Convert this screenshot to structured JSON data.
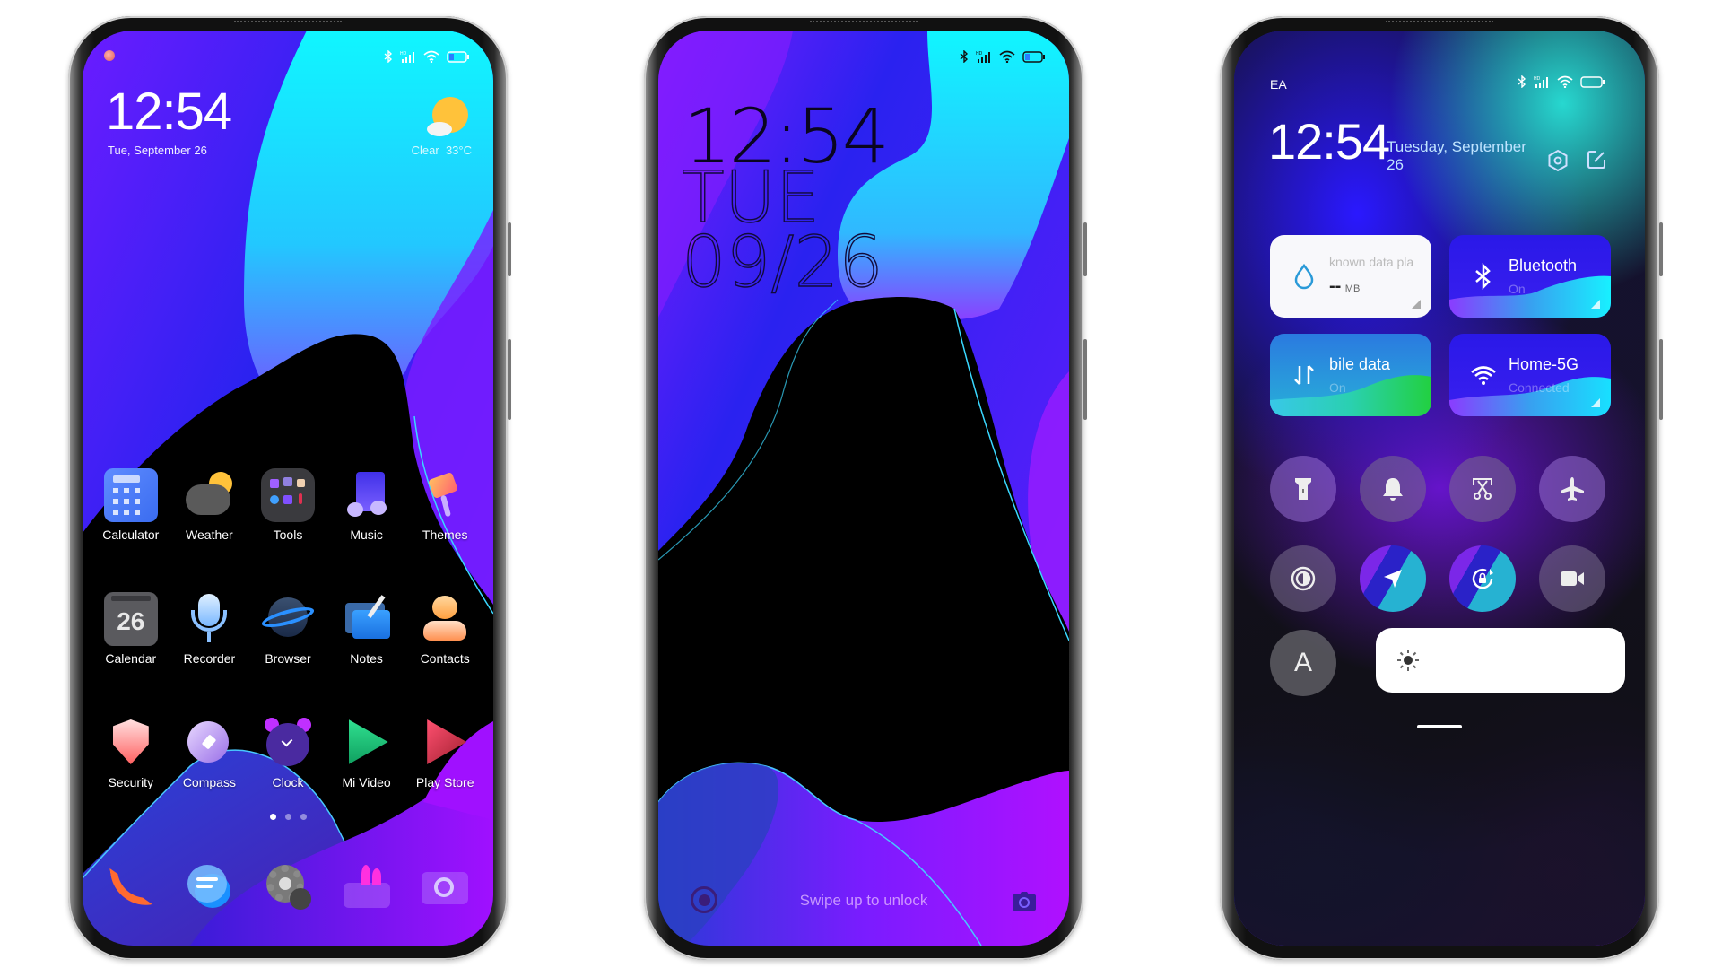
{
  "status_bar": {
    "icons": [
      "bluetooth-icon",
      "hd-signal-icon",
      "wifi-icon",
      "battery-icon"
    ]
  },
  "home_screen": {
    "clock": "12:54",
    "date": "Tue, September 26",
    "weather": {
      "condition": "Clear",
      "temperature": "33°C",
      "icon": "sun-cloud-icon"
    },
    "apps_row1": [
      {
        "label": "Calculator",
        "icon": "calculator-icon"
      },
      {
        "label": "Weather",
        "icon": "weather-icon"
      },
      {
        "label": "Tools",
        "icon": "tools-folder-icon"
      },
      {
        "label": "Music",
        "icon": "music-icon"
      },
      {
        "label": "Themes",
        "icon": "themes-icon"
      }
    ],
    "apps_row2": [
      {
        "label": "Calendar",
        "icon": "calendar-icon",
        "badge": "26"
      },
      {
        "label": "Recorder",
        "icon": "recorder-icon"
      },
      {
        "label": "Browser",
        "icon": "browser-icon"
      },
      {
        "label": "Notes",
        "icon": "notes-icon"
      },
      {
        "label": "Contacts",
        "icon": "contacts-icon"
      }
    ],
    "apps_row3": [
      {
        "label": "Security",
        "icon": "security-icon"
      },
      {
        "label": "Compass",
        "icon": "compass-icon"
      },
      {
        "label": "Clock",
        "icon": "clock-icon"
      },
      {
        "label": "Mi Video",
        "icon": "mi-video-icon"
      },
      {
        "label": "Play Store",
        "icon": "play-store-icon"
      }
    ],
    "page_indicator": {
      "pages": 3,
      "current": 1
    },
    "dock": [
      "phone-icon",
      "messages-icon",
      "settings-icon",
      "gallery-icon",
      "camera-icon"
    ]
  },
  "lock_screen": {
    "time": "12:54",
    "day": "TUE",
    "date": "09/26",
    "hint": "Swipe up to unlock"
  },
  "control_center": {
    "carrier": "EA",
    "time": "12:54",
    "date": "Tuesday, September 26",
    "tiles": [
      {
        "title": "known data pla",
        "value": "--",
        "unit": "MB",
        "icon": "water-drop-icon"
      },
      {
        "title": "Bluetooth",
        "sub": "On",
        "icon": "bluetooth-icon"
      },
      {
        "title": "bile data",
        "sub": "On",
        "icon": "mobile-data-icon"
      },
      {
        "title": "Home-5G",
        "sub": "Connected",
        "icon": "wifi-icon"
      }
    ],
    "toggles_row1": [
      "flashlight-icon",
      "bell-icon",
      "screenshot-icon",
      "airplane-icon"
    ],
    "toggles_row2": [
      "reading-mode-icon",
      "location-icon",
      "rotation-lock-icon",
      "screen-record-icon"
    ],
    "auto_brightness_label": "A",
    "brightness_level": 0.0
  },
  "colors": {
    "accent_cyan": "#10f0ff",
    "accent_blue": "#2a18ff",
    "accent_purple": "#a010ff"
  }
}
